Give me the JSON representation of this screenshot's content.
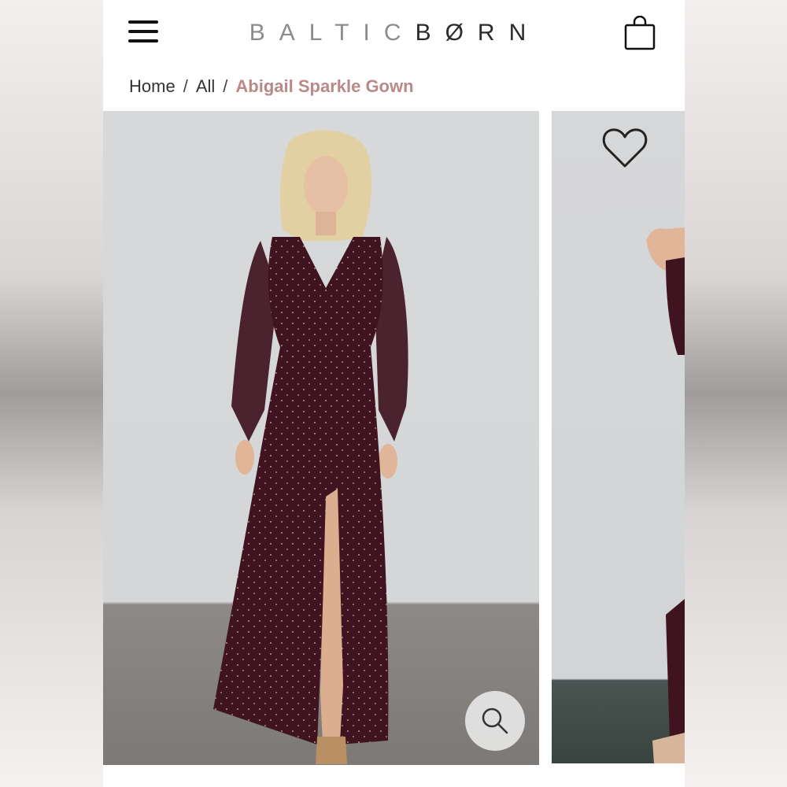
{
  "header": {
    "logo_light": "BALTIC",
    "logo_dark": "BØRN",
    "menu_icon": "hamburger-menu-icon",
    "cart_icon": "shopping-bag-icon"
  },
  "breadcrumb": {
    "items": [
      "Home",
      "All"
    ],
    "separator": "/",
    "current": "Abigail Sparkle Gown"
  },
  "gallery": {
    "favorite_icon": "heart-outline-icon",
    "zoom_icon": "magnifier-icon",
    "dress_color": "#3f1420"
  },
  "colors": {
    "breadcrumb_current": "#b98987",
    "text": "#333333"
  }
}
